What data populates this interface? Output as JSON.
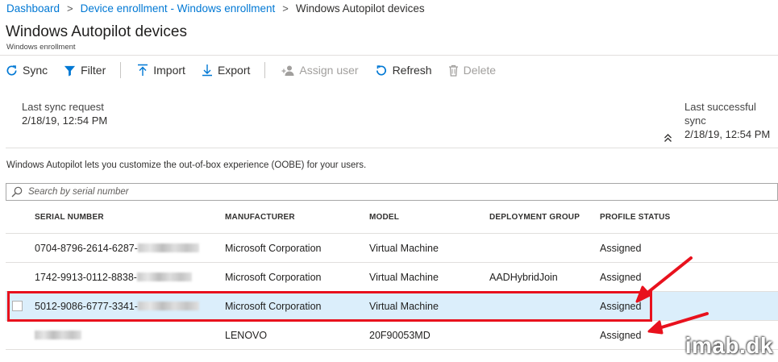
{
  "breadcrumb": {
    "items": [
      "Dashboard",
      "Device enrollment - Windows enrollment"
    ],
    "current": "Windows Autopilot devices",
    "separator": ">"
  },
  "page": {
    "title": "Windows Autopilot devices",
    "subtitle": "Windows enrollment"
  },
  "toolbar": {
    "sync": "Sync",
    "filter": "Filter",
    "import": "Import",
    "export": "Export",
    "assign_user": "Assign user",
    "refresh": "Refresh",
    "delete": "Delete"
  },
  "sync_info": {
    "last_request_label": "Last sync request",
    "last_request_value": "2/18/19, 12:54 PM",
    "last_success_label": "Last successful sync",
    "last_success_value": "2/18/19, 12:54 PM"
  },
  "description": "Windows Autopilot lets you customize the out-of-box experience (OOBE) for your users.",
  "search": {
    "placeholder": "Search by serial number"
  },
  "table": {
    "columns": [
      "SERIAL NUMBER",
      "MANUFACTURER",
      "MODEL",
      "DEPLOYMENT GROUP",
      "PROFILE STATUS"
    ],
    "rows": [
      {
        "serial": "0704-8796-2614-6287-",
        "manufacturer": "Microsoft Corporation",
        "model": "Virtual Machine",
        "group": "",
        "status": "Assigned"
      },
      {
        "serial": "1742-9913-0112-8838-",
        "manufacturer": "Microsoft Corporation",
        "model": "Virtual Machine",
        "group": "AADHybridJoin",
        "status": "Assigned"
      },
      {
        "serial": "5012-9086-6777-3341-",
        "manufacturer": "Microsoft Corporation",
        "model": "Virtual Machine",
        "group": "",
        "status": "Assigned"
      },
      {
        "serial": "",
        "manufacturer": "LENOVO",
        "model": "20F90053MD",
        "group": "",
        "status": "Assigned"
      }
    ]
  },
  "colors": {
    "link": "#0078d4",
    "selected_row": "#dbeefb",
    "annotation": "#e8111d"
  },
  "watermark": "imab.dk"
}
